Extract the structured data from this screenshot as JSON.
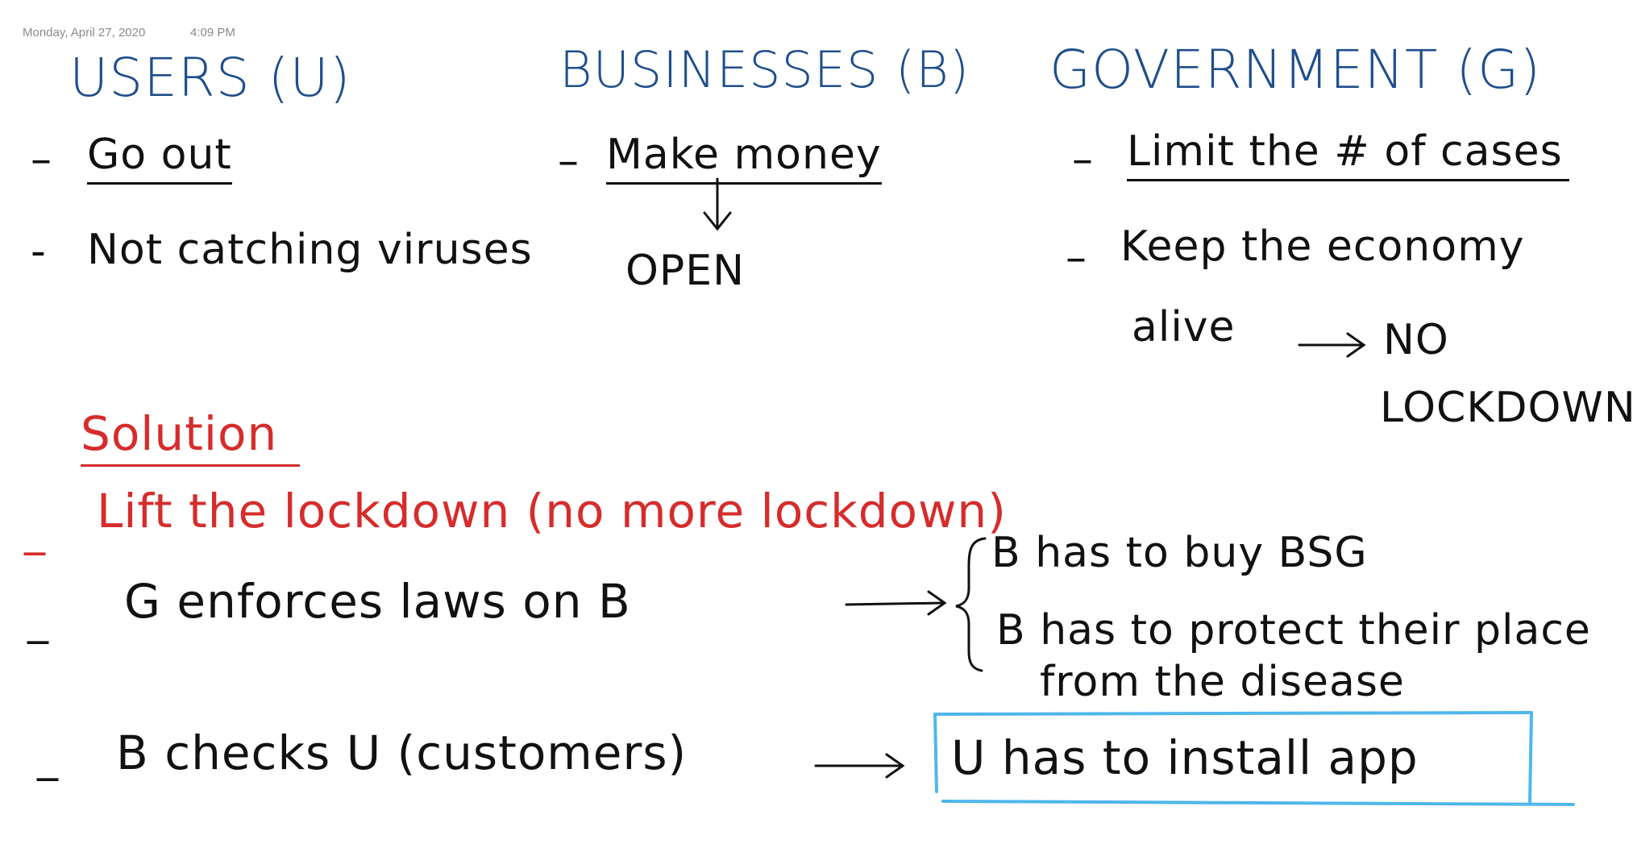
{
  "header": {
    "date": "Monday, April 27, 2020",
    "time": "4:09 PM"
  },
  "columns": {
    "users": {
      "title": "USERS (U)",
      "items": [
        "Go out",
        "Not catching viruses"
      ]
    },
    "businesses": {
      "title": "BUSINESSES (B)",
      "items": [
        "Make money"
      ],
      "result": "OPEN"
    },
    "government": {
      "title": "GOVERNMENT (G)",
      "items": [
        "Limit the # of cases",
        "Keep the economy",
        "alive"
      ],
      "result_line1": "NO",
      "result_line2": "LOCKDOWN"
    }
  },
  "solution": {
    "heading": "Solution",
    "lift": "Lift the lockdown (no more lockdown)",
    "enforce": "G enforces laws on B",
    "rules": [
      "B has to buy BSG",
      "B has to protect their place",
      "from the disease"
    ],
    "checks": "B checks U (customers)",
    "install": "U has to install app"
  },
  "colors": {
    "ink_blue": "#1f4e8c",
    "ink_black": "#111111",
    "ink_red": "#d62c2c",
    "highlight_box": "#4fb6ec",
    "meta_gray": "#8a8a8a"
  }
}
